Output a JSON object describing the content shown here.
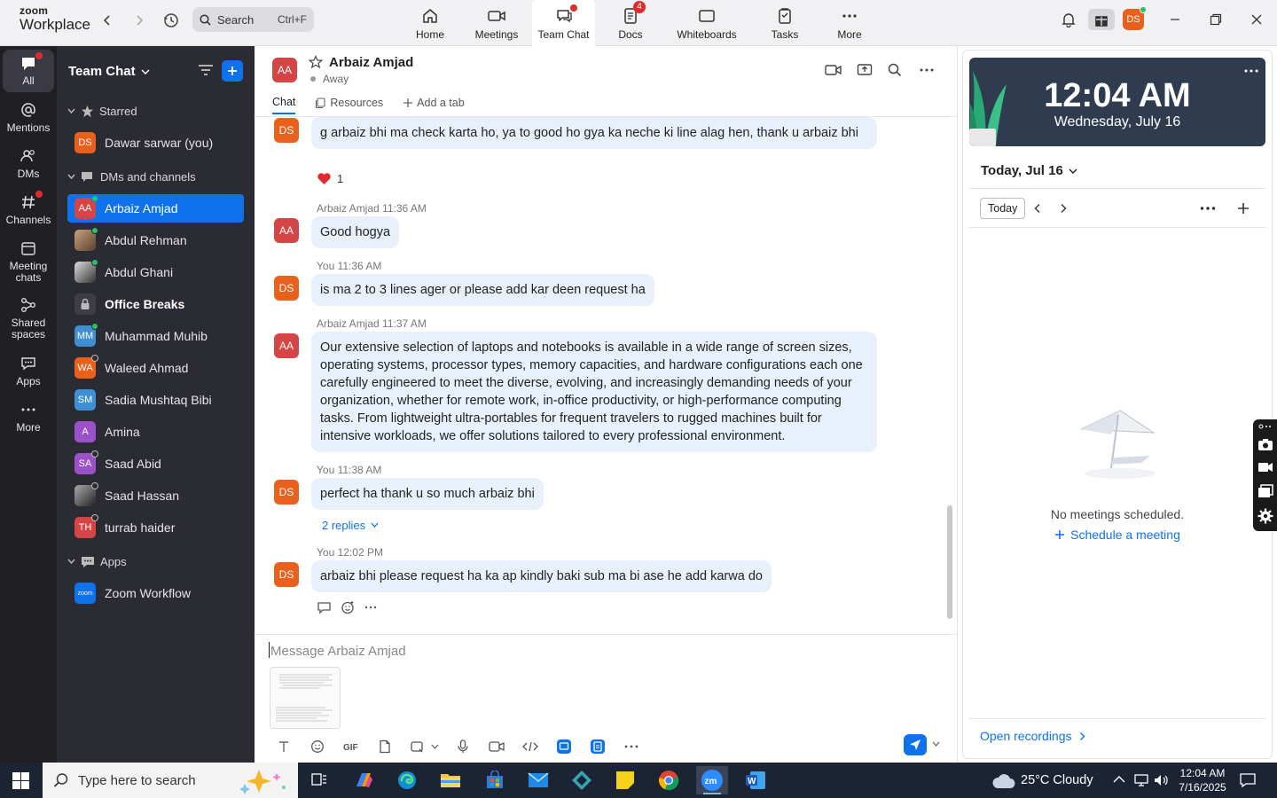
{
  "app": {
    "logo_line1": "zoom",
    "logo_line2": "Workplace",
    "search_placeholder": "Search",
    "search_shortcut": "Ctrl+F",
    "user_initials": "DS"
  },
  "colors": {
    "accent": "#0e72ed",
    "rail_bg": "#1f1f24",
    "sidebar_bg": "#2b2b33",
    "bubble_bg": "#e8f1fb",
    "badge": "#e02b2b"
  },
  "topnav": [
    {
      "label": "Home",
      "icon": "home-icon"
    },
    {
      "label": "Meetings",
      "icon": "video-camera-icon"
    },
    {
      "label": "Team Chat",
      "icon": "chat-icon",
      "active": true
    },
    {
      "label": "Docs",
      "icon": "docs-icon",
      "badge": "4"
    },
    {
      "label": "Whiteboards",
      "icon": "whiteboard-icon"
    },
    {
      "label": "Tasks",
      "icon": "tasks-icon"
    },
    {
      "label": "More",
      "icon": "more-icon"
    }
  ],
  "rail": [
    {
      "label": "All"
    },
    {
      "label": "Mentions"
    },
    {
      "label": "DMs"
    },
    {
      "label": "Channels"
    },
    {
      "label": "Meeting chats"
    },
    {
      "label": "Shared spaces"
    },
    {
      "label": "Apps"
    },
    {
      "label": "More"
    }
  ],
  "sidebar": {
    "title": "Team Chat",
    "sections": {
      "starred": "Starred",
      "dms": "DMs and channels",
      "apps": "Apps"
    },
    "starred": [
      {
        "initials": "DS",
        "name": "Dawar sarwar (you)",
        "color": "#e8601c"
      }
    ],
    "items": [
      {
        "initials": "AA",
        "name": "Arbaiz Amjad",
        "color": "#d64545"
      },
      {
        "initials": "",
        "name": "Abdul Rehman",
        "color": "#8a6a5a"
      },
      {
        "initials": "",
        "name": "Abdul Ghani",
        "color": "#5a5a5a"
      },
      {
        "initials": "",
        "name": "Office Breaks",
        "color": "#3d3d46"
      },
      {
        "initials": "MM",
        "name": "Muhammad Muhib",
        "color": "#3f8fd2"
      },
      {
        "initials": "WA",
        "name": "Waleed Ahmad",
        "color": "#e8601c"
      },
      {
        "initials": "SM",
        "name": "Sadia Mushtaq Bibi",
        "color": "#3f8fd2"
      },
      {
        "initials": "A",
        "name": "Amina",
        "color": "#9b51c8"
      },
      {
        "initials": "SA",
        "name": "Saad Abid",
        "color": "#9b51c8"
      },
      {
        "initials": "",
        "name": "Saad Hassan",
        "color": "#555"
      },
      {
        "initials": "TH",
        "name": "turrab haider",
        "color": "#d64545"
      }
    ],
    "apps": [
      {
        "initials": "zoom",
        "name": "Zoom Workflow",
        "color": "#0e72ed"
      }
    ]
  },
  "chat": {
    "contact_initials": "AA",
    "contact_name": "Arbaiz Amjad",
    "contact_status": "Away",
    "tabs": {
      "chat": "Chat",
      "resources": "Resources",
      "add": "Add a tab"
    },
    "messages": [
      {
        "initials": "DS",
        "meta": "",
        "text": "g arbaiz bhi ma check karta ho, ya to good ho gya ka neche ki line alag hen, thank u arbaiz bhi"
      },
      {
        "initials": "AA",
        "meta": "Arbaiz Amjad 11:36 AM",
        "text": "Good hogya"
      },
      {
        "initials": "DS",
        "meta": "You 11:36 AM",
        "text": "is ma 2 to 3 lines ager or please add kar deen request ha"
      },
      {
        "initials": "AA",
        "meta": "Arbaiz Amjad 11:37 AM",
        "text": "Our extensive selection of laptops and notebooks is available in a wide range of screen sizes, operating systems, processor types, memory capacities, and hardware configurations each one carefully engineered to meet the diverse, evolving, and increasingly demanding needs of your organization, whether for remote work, in-office productivity, or high-performance computing tasks. From lightweight ultra-portables for frequent travelers to rugged machines built for intensive workloads, we offer solutions tailored to every professional environment."
      },
      {
        "initials": "DS",
        "meta": "You 11:38 AM",
        "text": "perfect ha thank u so much arbaiz bhi"
      },
      {
        "initials": "DS",
        "meta": "You 12:02 PM",
        "text": "arbaiz bhi please request ha ka ap kindly baki sub ma bi ase he add karwa do"
      }
    ],
    "reaction_count": "1",
    "replies_label": "2 replies",
    "composer_placeholder": "Message Arbaiz Amjad"
  },
  "calendar": {
    "time": "12:04 AM",
    "date": "Wednesday, July 16",
    "today_header": "Today, Jul 16",
    "today_button": "Today",
    "no_meetings": "No meetings scheduled.",
    "schedule_link": "Schedule a meeting",
    "open_recordings": "Open recordings"
  },
  "taskbar": {
    "search_placeholder": "Type here to search",
    "weather": "25°C  Cloudy",
    "time": "12:04 AM",
    "date": "7/16/2025"
  }
}
